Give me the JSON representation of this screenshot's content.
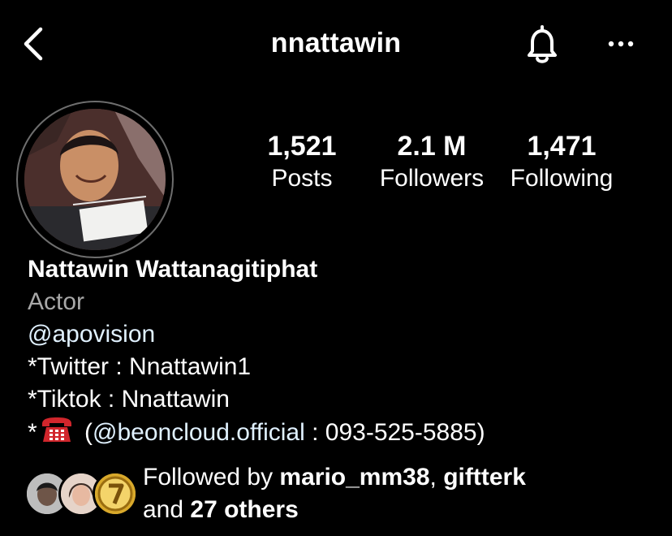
{
  "header": {
    "username": "nnattawin",
    "back_icon": "chevron-left-icon",
    "bell_icon": "bell-icon",
    "more_icon": "more-horizontal-icon"
  },
  "stats": {
    "posts": {
      "value": "1,521",
      "label": "Posts"
    },
    "followers": {
      "value": "2.1 M",
      "label": "Followers"
    },
    "following": {
      "value": "1,471",
      "label": "Following"
    }
  },
  "bio": {
    "full_name": "Nattawin Wattanagitiphat",
    "category": "Actor",
    "mention": "@apovision",
    "twitter": "*Twitter : Nnattawin1",
    "tiktok": "*Tiktok : Nnattawin",
    "contact_prefix": "*",
    "contact_icon": "telephone-icon",
    "contact_open": " (",
    "contact_mention": "@beoncloud.official",
    "contact_rest": " : 093-525-5885)"
  },
  "followed_by": {
    "prefix": "Followed by ",
    "user1": "mario_mm38",
    "separator": ", ",
    "user2": "giftterk",
    "line2_prefix": "and ",
    "others": "27 others"
  },
  "colors": {
    "background": "#000000",
    "text": "#ffffff",
    "category": "#a8a8a8",
    "mention": "#e0f1ff",
    "phone_icon": "#d1262c"
  }
}
